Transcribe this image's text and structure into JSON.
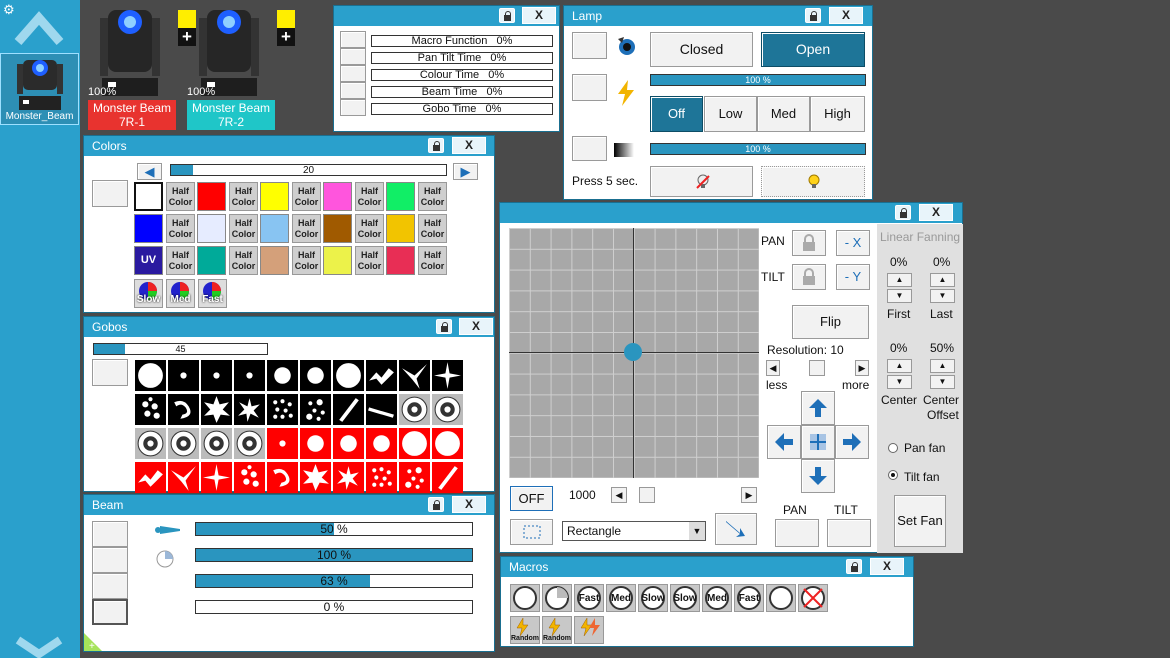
{
  "sidebar": {
    "fixture_label": "Monster_Beam"
  },
  "fixtures": [
    {
      "pct": "100%",
      "name": "Monster Beam",
      "id": "7R-1",
      "color": "#e8332f"
    },
    {
      "pct": "100%",
      "name": "Monster Beam",
      "id": "7R-2",
      "color": "#1fc6c8"
    }
  ],
  "macro_panel": {
    "rows": [
      {
        "label": "Macro Function",
        "value": "0%"
      },
      {
        "label": "Pan Tilt Time",
        "value": "0%"
      },
      {
        "label": "Colour Time",
        "value": "0%"
      },
      {
        "label": "Beam Time",
        "value": "0%"
      },
      {
        "label": "Gobo Time",
        "value": "0%"
      }
    ]
  },
  "lamp": {
    "title": "Lamp",
    "closed": "Closed",
    "open": "Open",
    "bar1": "100 %",
    "bar1_fraction": 1.0,
    "levels": [
      "Off",
      "Low",
      "Med",
      "High"
    ],
    "bar2": "100 %",
    "bar2_fraction": 1.0,
    "press": "Press 5 sec."
  },
  "colors": {
    "title": "Colors",
    "slider_value": "20",
    "slider_fraction": 0.08,
    "half_label_1": "Half",
    "half_label_2": "Color",
    "rows": [
      [
        "#ffffff",
        "#ff0000",
        "#ffff00",
        "#ff55dd",
        "#11ee66"
      ],
      [
        "#0000ff",
        "#e6ecff",
        "#88c4f2",
        "#a05a00",
        "#f2c400"
      ],
      [
        "#2a1aa0",
        "#00aa99",
        "#d4a07a",
        "#ecf24a",
        "#e82e55"
      ]
    ],
    "uv": "UV",
    "speed": [
      "Slow",
      "Med",
      "Fast"
    ]
  },
  "gobos": {
    "title": "Gobos",
    "slider_value": "45",
    "slider_fraction": 0.18
  },
  "beam": {
    "title": "Beam",
    "bars": [
      {
        "text": "50 %",
        "fraction": 0.5
      },
      {
        "text": "100 %",
        "fraction": 1.0
      },
      {
        "text": "63 %",
        "fraction": 0.63
      },
      {
        "text": "0 %",
        "fraction": 0.0
      }
    ]
  },
  "pantilt": {
    "pan": "PAN",
    "tilt": "TILT",
    "neg_x": "- X",
    "neg_y": "- Y",
    "flip": "Flip",
    "resolution": "Resolution: 10",
    "less": "less",
    "more": "more",
    "off": "OFF",
    "speed_value": "1000",
    "shape": "Rectangle",
    "pan_bottom": "PAN",
    "tilt_bottom": "TILT",
    "fanning": {
      "title": "Linear Fanning",
      "first_pct": "0%",
      "last_pct": "0%",
      "first": "First",
      "last": "Last",
      "center_pct": "0%",
      "offset_pct": "50%",
      "center": "Center",
      "center_offset_1": "Center",
      "center_offset_2": "Offset",
      "pan_fan": "Pan fan",
      "tilt_fan": "Tilt fan",
      "set_fan": "Set Fan"
    }
  },
  "macros": {
    "title": "Macros",
    "row1": [
      "",
      "",
      "Fast",
      "Med",
      "Slow",
      "Slow",
      "Med",
      "Fast",
      "",
      ""
    ],
    "row2": [
      "Random",
      "Random",
      ""
    ]
  }
}
